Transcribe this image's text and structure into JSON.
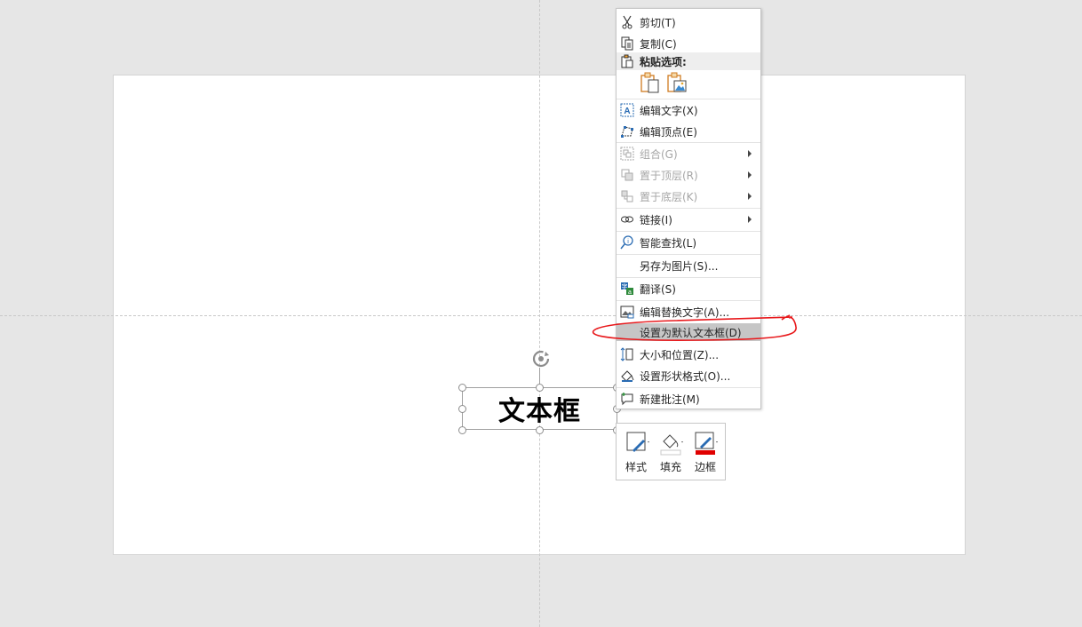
{
  "slide": {
    "textbox_text": "文本框"
  },
  "context_menu": {
    "items": [
      {
        "label": "剪切(T)",
        "icon": "scissors-icon",
        "disabled": false
      },
      {
        "label": "复制(C)",
        "icon": "copy-icon",
        "disabled": false
      },
      {
        "label": "粘贴选项:",
        "icon": "clipboard-icon",
        "disabled": false,
        "header": true
      },
      {
        "label": "编辑文字(X)",
        "icon": "edit-text-icon",
        "disabled": false
      },
      {
        "label": "编辑顶点(E)",
        "icon": "edit-points-icon",
        "disabled": false
      },
      {
        "label": "组合(G)",
        "icon": "group-icon",
        "disabled": true,
        "submenu": true
      },
      {
        "label": "置于顶层(R)",
        "icon": "bring-to-front-icon",
        "disabled": true,
        "submenu": true
      },
      {
        "label": "置于底层(K)",
        "icon": "send-to-back-icon",
        "disabled": true,
        "submenu": true
      },
      {
        "label": "链接(I)",
        "icon": "link-icon",
        "disabled": false,
        "submenu": true
      },
      {
        "label": "智能查找(L)",
        "icon": "smart-lookup-icon",
        "disabled": false
      },
      {
        "label": "另存为图片(S)...",
        "icon": "",
        "disabled": false
      },
      {
        "label": "翻译(S)",
        "icon": "translate-icon",
        "disabled": false
      },
      {
        "label": "编辑替换文字(A)...",
        "icon": "alt-text-icon",
        "disabled": false
      },
      {
        "label": "设置为默认文本框(D)",
        "icon": "",
        "disabled": false,
        "highlighted": true
      },
      {
        "label": "大小和位置(Z)...",
        "icon": "size-position-icon",
        "disabled": false
      },
      {
        "label": "设置形状格式(O)...",
        "icon": "format-shape-icon",
        "disabled": false
      },
      {
        "label": "新建批注(M)",
        "icon": "new-comment-icon",
        "disabled": false
      }
    ],
    "paste_options": [
      "paste-keep-formatting-icon",
      "paste-picture-icon"
    ]
  },
  "mini_toolbar": {
    "style_label": "样式",
    "fill_label": "填充",
    "border_label": "边框",
    "border_color": "#e00000"
  },
  "colors": {
    "annotation": "#e8191c",
    "highlight": "#c6c6c6"
  }
}
